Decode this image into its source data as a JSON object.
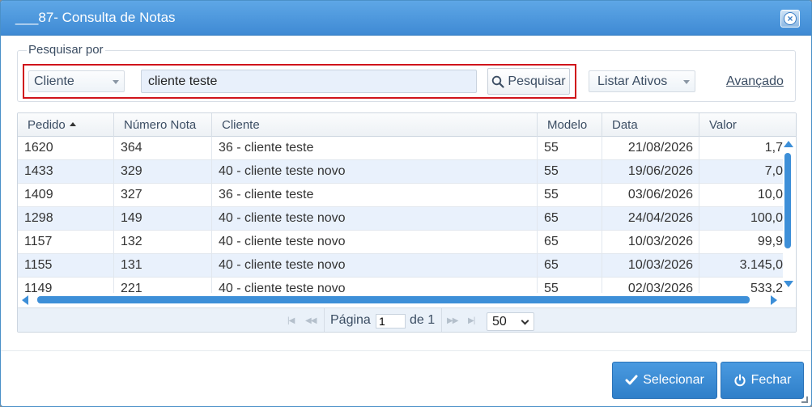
{
  "window": {
    "title": "___87- Consulta de Notas"
  },
  "search": {
    "legend": "Pesquisar por",
    "field_select": "Cliente",
    "query_value": "cliente teste",
    "search_button": "Pesquisar",
    "status_select": "Listar Ativos",
    "advanced_link": "Avançado"
  },
  "grid": {
    "columns": [
      "Pedido",
      "Número Nota",
      "Cliente",
      "Modelo",
      "Data",
      "Valor"
    ],
    "sorted_column": "Pedido",
    "rows": [
      [
        "1620",
        "364",
        "36 - cliente teste",
        "55",
        "21/08/2026",
        "1,7"
      ],
      [
        "1433",
        "329",
        "40 - cliente teste novo",
        "55",
        "19/06/2026",
        "7,0"
      ],
      [
        "1409",
        "327",
        "36 - cliente teste",
        "55",
        "03/06/2026",
        "10,0"
      ],
      [
        "1298",
        "149",
        "40 - cliente teste novo",
        "65",
        "24/04/2026",
        "100,0"
      ],
      [
        "1157",
        "132",
        "40 - cliente teste novo",
        "65",
        "10/03/2026",
        "99,9"
      ],
      [
        "1155",
        "131",
        "40 - cliente teste novo",
        "65",
        "10/03/2026",
        "3.145,0"
      ],
      [
        "1149",
        "221",
        "40 - cliente teste novo",
        "55",
        "02/03/2026",
        "533,2"
      ]
    ]
  },
  "pager": {
    "page_label": "Página",
    "current_page": "1",
    "of_label": "de 1",
    "page_size": "50"
  },
  "footer": {
    "select_button": "Selecionar",
    "close_button": "Fechar"
  },
  "colors": {
    "accent": "#3d8fd8",
    "highlight_border": "#d0141b",
    "alt_row": "#e9f1fc"
  }
}
